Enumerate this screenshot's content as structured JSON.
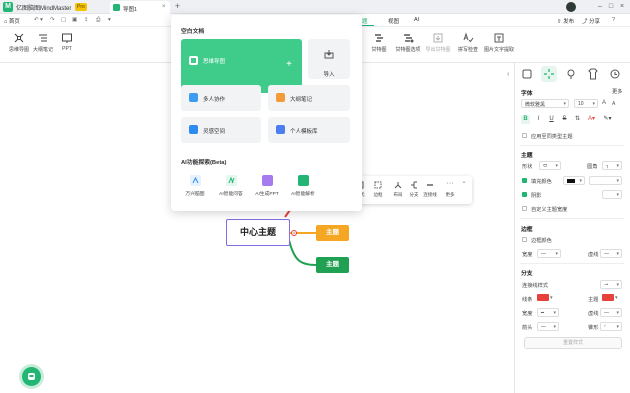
{
  "app": {
    "name": "亿图脑图MindMaster",
    "badge": "Pro",
    "doc_tab": "导图1"
  },
  "menubar": {
    "home": "首页",
    "items": [
      "题",
      "视图",
      "AI"
    ],
    "right": [
      "发布",
      "分享"
    ]
  },
  "ribbon_left": [
    "思维导图",
    "大纲笔记",
    "PPT"
  ],
  "ribbon_right": [
    "甘特图",
    "甘特图选项",
    "导出甘特图",
    "拼写检查",
    "图片文字提取"
  ],
  "popup": {
    "section_blank": "空白文档",
    "cards": {
      "mindmap": "思维导图",
      "import": "导入",
      "collab": "多人协作",
      "outline": "大纲笔记",
      "inspire": "灵感空间",
      "templates": "个人模板库"
    },
    "section_ai": "AI功能探索(Beta)",
    "ai_items": [
      "万兴脑图",
      "AI智能问答",
      "AI生成PPT",
      "AI智能解析"
    ]
  },
  "ctx_toolbar": [
    "样式",
    "边框",
    "布局",
    "分支",
    "连接线",
    "更多"
  ],
  "mindmap": {
    "central": "中心主题",
    "sub1": "主题",
    "sub2": "主题"
  },
  "right_panel": {
    "font": {
      "section": "字体",
      "more": "更多",
      "family": "微软雅黑",
      "size": "10",
      "apply_same_level": "应用至同类型主题"
    },
    "topic": {
      "section": "主题",
      "shape": "形状",
      "border_style": "圆角",
      "fill_label": "填充颜色",
      "shadow_label": "阴影",
      "custom_width": "自定义主题宽度"
    },
    "border": {
      "section": "边框",
      "border_color": "边框颜色",
      "width": "宽度",
      "dash": "虚线"
    },
    "branch": {
      "section": "分支",
      "connector_style": "连接线样式",
      "line": "线条",
      "topic": "主题",
      "width": "宽度",
      "dash": "虚线",
      "arrow": "箭头",
      "taper": "锥形"
    },
    "bottom_button": "重置样式"
  },
  "colors": {
    "accent": "#22b573",
    "orange_topic": "#f5a623",
    "green_topic": "#1fa052",
    "central_border": "#7e6fe2",
    "branch_red": "#e8403a"
  }
}
